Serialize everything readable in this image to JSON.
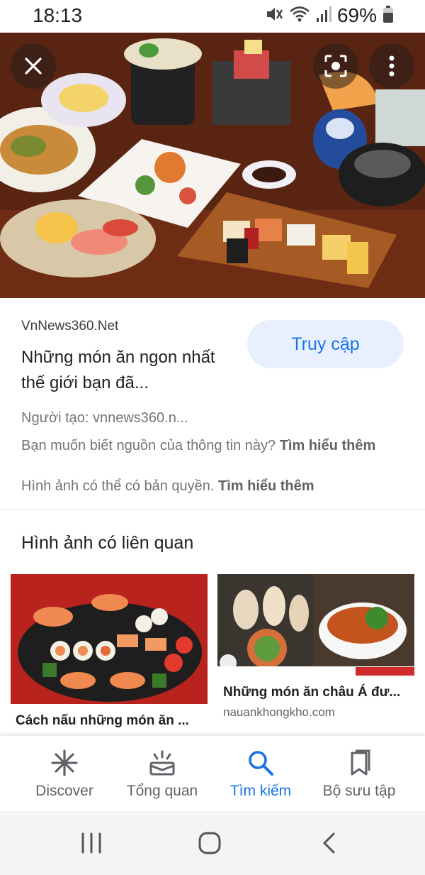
{
  "status_bar": {
    "time": "18:13",
    "battery_percent": "69%"
  },
  "hero": {
    "close_label": "close",
    "lens_label": "lens",
    "more_label": "more"
  },
  "result": {
    "source": "VnNews360.Net",
    "title": "Những món ăn ngon nhất thế giới bạn đã...",
    "visit_button": "Truy cập",
    "creator": "Người tạo: vnnews360.n...",
    "source_question": "Bạn muốn biết nguồn của thông tin này? ",
    "learn_more_1": "Tìm hiểu thêm",
    "copyright_note": "Hình ảnh có thể có bản quyền. ",
    "learn_more_2": "Tìm hiểu thêm"
  },
  "related": {
    "heading": "Hình ảnh có liên quan",
    "items": [
      {
        "title": "Cách nấu những món ăn ...",
        "site": ""
      },
      {
        "title": "Những món ăn châu Á đư...",
        "site": "nauankhongkho.com"
      }
    ]
  },
  "bottom_nav": {
    "items": [
      {
        "label": "Discover",
        "icon": "asterisk-icon",
        "active": false
      },
      {
        "label": "Tổng quan",
        "icon": "updates-icon",
        "active": false
      },
      {
        "label": "Tìm kiếm",
        "icon": "search-icon",
        "active": true
      },
      {
        "label": "Bộ sưu tập",
        "icon": "collections-icon",
        "active": false
      }
    ]
  },
  "colors": {
    "accent": "#1a73e8",
    "visit_button_bg": "#e8f0fe",
    "muted_text": "#70757a"
  }
}
